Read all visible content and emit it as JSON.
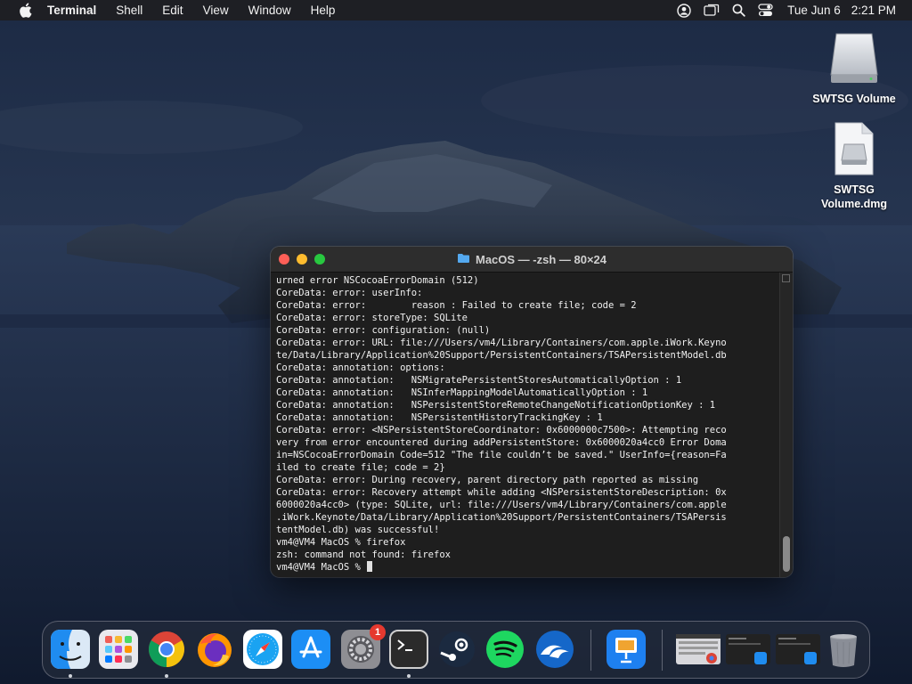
{
  "menubar": {
    "app_name": "Terminal",
    "menus": [
      "Shell",
      "Edit",
      "View",
      "Window",
      "Help"
    ],
    "date": "Tue Jun 6",
    "time": "2:21 PM"
  },
  "desktop": {
    "icons": [
      {
        "label": "SWTSG Volume",
        "icon": "drive-icon"
      },
      {
        "label": "SWTSG Volume.dmg",
        "icon": "disk-image-icon"
      }
    ]
  },
  "terminal": {
    "title": "MacOS — -zsh — 80×24",
    "lines": [
      "urned error NSCocoaErrorDomain (512)",
      "CoreData: error: userInfo:",
      "CoreData: error:        reason : Failed to create file; code = 2",
      "CoreData: error: storeType: SQLite",
      "CoreData: error: configuration: (null)",
      "CoreData: error: URL: file:///Users/vm4/Library/Containers/com.apple.iWork.Keyno",
      "te/Data/Library/Application%20Support/PersistentContainers/TSAPersistentModel.db",
      "CoreData: annotation: options:",
      "CoreData: annotation:   NSMigratePersistentStoresAutomaticallyOption : 1",
      "CoreData: annotation:   NSInferMappingModelAutomaticallyOption : 1",
      "CoreData: annotation:   NSPersistentStoreRemoteChangeNotificationOptionKey : 1",
      "CoreData: annotation:   NSPersistentHistoryTrackingKey : 1",
      "CoreData: error: <NSPersistentStoreCoordinator: 0x6000000c7500>: Attempting reco",
      "very from error encountered during addPersistentStore: 0x6000020a4cc0 Error Doma",
      "in=NSCocoaErrorDomain Code=512 \"The file couldn’t be saved.\" UserInfo={reason=Fa",
      "iled to create file; code = 2}",
      "CoreData: error: During recovery, parent directory path reported as missing",
      "CoreData: error: Recovery attempt while adding <NSPersistentStoreDescription: 0x",
      "6000020a4cc0> (type: SQLite, url: file:///Users/vm4/Library/Containers/com.apple",
      ".iWork.Keynote/Data/Library/Application%20Support/PersistentContainers/TSAPersis",
      "tentModel.db) was successful!",
      "vm4@VM4 MacOS % firefox",
      "zsh: command not found: firefox"
    ],
    "prompt": "vm4@VM4 MacOS % "
  },
  "dock": {
    "apps": [
      {
        "name": "Finder",
        "icon": "finder-icon",
        "running": true
      },
      {
        "name": "Launchpad",
        "icon": "launchpad-icon",
        "running": false
      },
      {
        "name": "Google Chrome",
        "icon": "chrome-icon",
        "running": true
      },
      {
        "name": "Firefox",
        "icon": "firefox-icon",
        "running": false
      },
      {
        "name": "Safari",
        "icon": "safari-icon",
        "running": false
      },
      {
        "name": "App Store",
        "icon": "app-store-icon",
        "running": false
      },
      {
        "name": "System Preferences",
        "icon": "system-preferences-icon",
        "running": false,
        "badge": "1"
      },
      {
        "name": "Terminal",
        "icon": "terminal-icon",
        "running": true
      },
      {
        "name": "Steam",
        "icon": "steam-icon",
        "running": false
      },
      {
        "name": "Spotify",
        "icon": "spotify-icon",
        "running": false
      },
      {
        "name": "OpenOffice",
        "icon": "openoffice-icon",
        "running": false
      },
      {
        "name": "Keynote",
        "icon": "keynote-icon",
        "running": false
      }
    ],
    "minimized": [
      "chrome-window-thumbnail",
      "finder-window-thumbnail-1",
      "finder-window-thumbnail-2"
    ],
    "trash": "trash-icon"
  }
}
